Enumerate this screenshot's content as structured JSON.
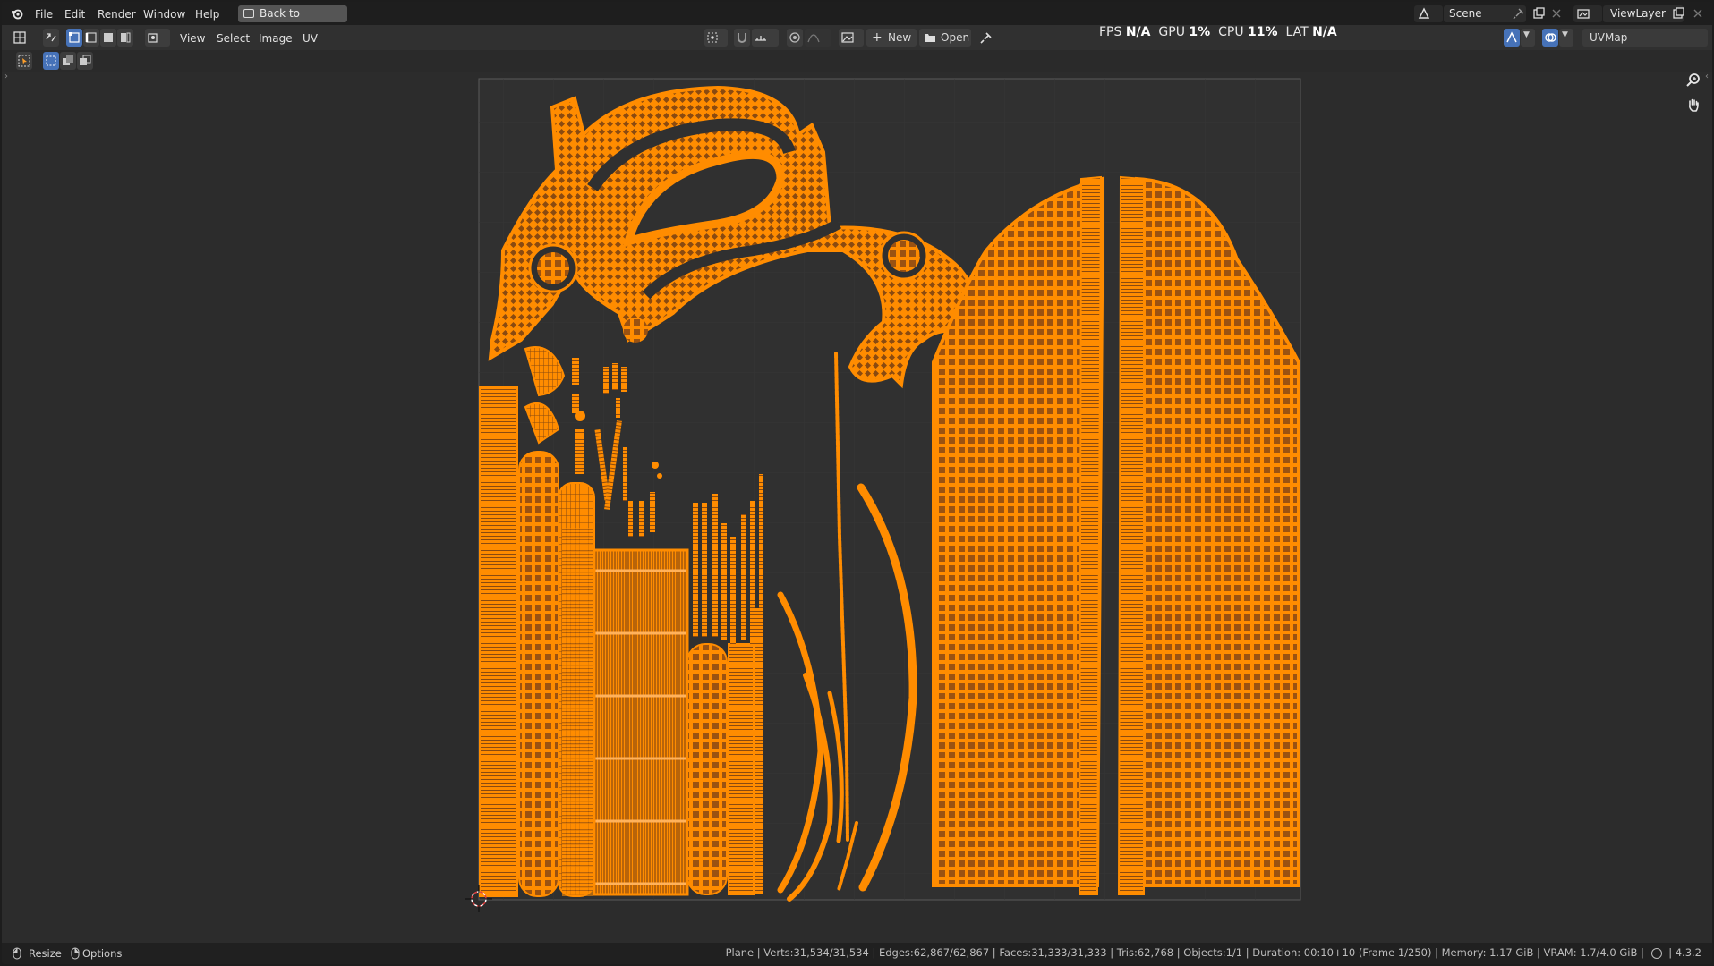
{
  "menubar": {
    "items": [
      "File",
      "Edit",
      "Render",
      "Window",
      "Help"
    ],
    "back_button": "Back to Previous",
    "scene": "Scene",
    "view_layer": "ViewLayer"
  },
  "header": {
    "menus": [
      "View",
      "Select",
      "Image",
      "UV"
    ],
    "new_label": "New",
    "open_label": "Open",
    "uv_map": "UVMap"
  },
  "stats": {
    "fps_label": "FPS",
    "fps": "N/A",
    "gpu_label": "GPU",
    "gpu": "1%",
    "cpu_label": "CPU",
    "cpu": "11%",
    "lat_label": "LAT",
    "lat": "N/A"
  },
  "statusbar": {
    "resize": "Resize",
    "options": "Options",
    "info": "Plane | Verts:31,534/31,534 | Edges:62,867/62,867 | Faces:31,333/31,333 | Tris:62,768 | Objects:1/1 | Duration: 00:10+10 (Frame 1/250) | Memory: 1.17 GiB | VRAM: 1.7/4.0 GiB |",
    "version": "4.3.2"
  },
  "colors": {
    "uv_orange": "#ff8c00",
    "uv_dark": "#8a4a10",
    "background": "#2c2c2c",
    "accent_blue": "#4672b8"
  },
  "icons": [
    "blender-logo-icon",
    "back-icon",
    "scene-icon",
    "pin-icon",
    "new-icon",
    "open-folder-icon",
    "zoom-icon",
    "hand-pan-icon",
    "cursor-icon"
  ]
}
